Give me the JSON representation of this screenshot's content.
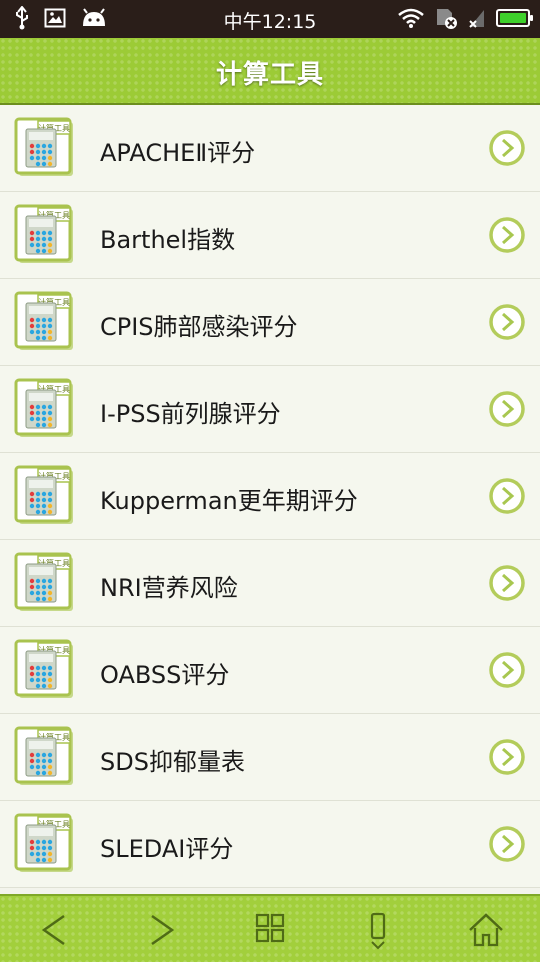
{
  "status_bar": {
    "time": "中午12:15",
    "icons_left": [
      "usb-icon",
      "image-icon",
      "android-icon"
    ],
    "icons_right": [
      "wifi-icon",
      "sd-card-icon",
      "signal-icon",
      "battery-icon"
    ]
  },
  "header": {
    "title": "计算工具"
  },
  "icon_label": "计算工具",
  "list": {
    "items": [
      {
        "label": "APACHEⅡ评分"
      },
      {
        "label": "Barthel指数"
      },
      {
        "label": "CPIS肺部感染评分"
      },
      {
        "label": "I-PSS前列腺评分"
      },
      {
        "label": "Kupperman更年期评分"
      },
      {
        "label": "NRI营养风险"
      },
      {
        "label": "OABSS评分"
      },
      {
        "label": "SDS抑郁量表"
      },
      {
        "label": "SLEDAI评分"
      }
    ]
  },
  "bottom_nav": [
    "back-icon",
    "forward-icon",
    "grid-icon",
    "phone-icon",
    "home-icon"
  ],
  "colors": {
    "status_bg": "#2a1e19",
    "header_green": "#9ccb36",
    "list_bg": "#f5f7ee",
    "accent": "#a8c750"
  }
}
